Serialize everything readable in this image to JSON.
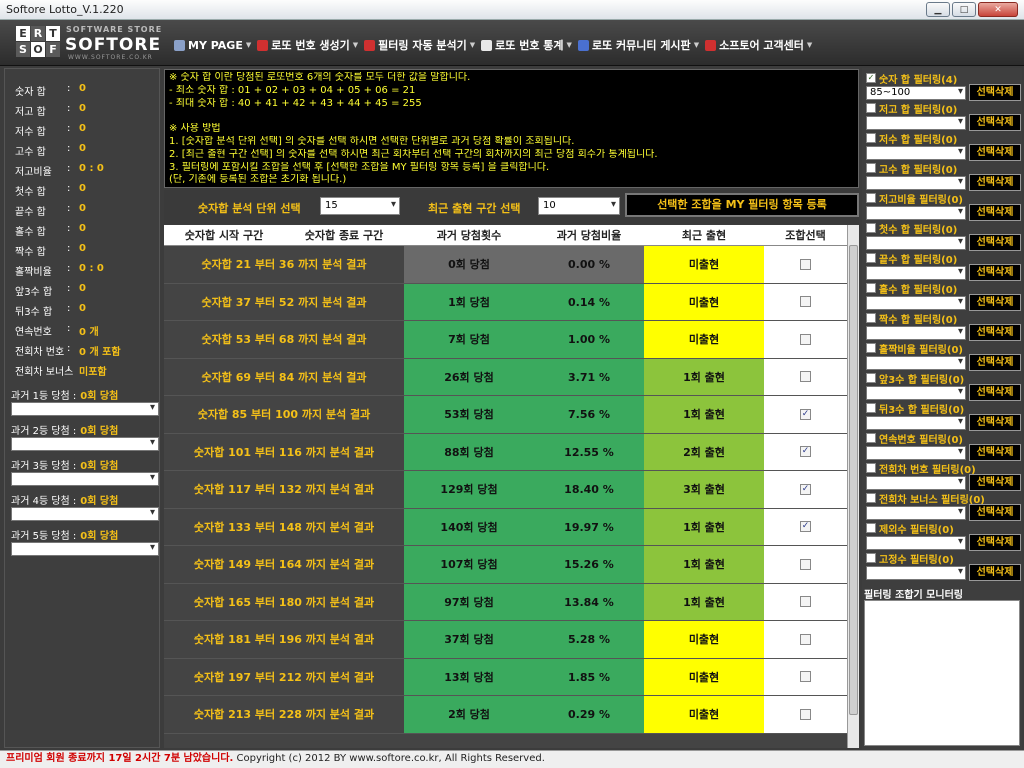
{
  "window": {
    "title": "Softore Lotto_V.1.220"
  },
  "logo": {
    "letters": [
      "E",
      "R",
      "T",
      "S",
      "O",
      "F"
    ],
    "sub1": "SOFTWARE STORE",
    "main": "SOFTORE",
    "sub2": "WWW.SOFTORE.CO.KR"
  },
  "menu": [
    {
      "label": "MY PAGE",
      "icon": "grid-icon",
      "color": "#8aa0c8"
    },
    {
      "label": "로또 번호 생성기",
      "icon": "dice-icon",
      "color": "#d03030"
    },
    {
      "label": "필터링 자동 분석기",
      "icon": "dice-icon",
      "color": "#d03030"
    },
    {
      "label": "로또 번호 통계",
      "icon": "document-icon",
      "color": "#e8e8e8"
    },
    {
      "label": "로또 커뮤니티 게시판",
      "icon": "board-icon",
      "color": "#4a70d0"
    },
    {
      "label": "소프토어 고객센터",
      "icon": "help-icon",
      "color": "#d03030"
    }
  ],
  "left_stats": [
    {
      "label": "숫자 합",
      "value": "0"
    },
    {
      "label": "저고 합",
      "value": "0"
    },
    {
      "label": "저수 합",
      "value": "0"
    },
    {
      "label": "고수 합",
      "value": "0"
    },
    {
      "label": "저고비율",
      "value": "0 : 0"
    },
    {
      "label": "첫수 합",
      "value": "0"
    },
    {
      "label": "끝수 합",
      "value": "0"
    },
    {
      "label": "홀수 합",
      "value": "0"
    },
    {
      "label": "짝수 합",
      "value": "0"
    },
    {
      "label": "홀짝비율",
      "value": "0 : 0"
    },
    {
      "label": "앞3수 합",
      "value": "0"
    },
    {
      "label": "뒤3수 합",
      "value": "0"
    },
    {
      "label": "연속번호",
      "value": "0 개"
    },
    {
      "label": "전회차 번호",
      "value": "0 개 포함"
    },
    {
      "label": "전회차 보너스",
      "value": "미포함"
    }
  ],
  "past_wins": [
    {
      "label": "과거 1등 당첨 :",
      "value": "0회 당첨"
    },
    {
      "label": "과거 2등 당첨 :",
      "value": "0회 당첨"
    },
    {
      "label": "과거 3등 당첨 :",
      "value": "0회 당첨"
    },
    {
      "label": "과거 4등 당첨 :",
      "value": "0회 당첨"
    },
    {
      "label": "과거 5등 당첨 :",
      "value": "0회 당첨"
    }
  ],
  "info_lines": [
    "※ 숫자 합 이란 당첨된 로또번호 6개의 숫자를 모두 더한 값을 말합니다.",
    " - 최소 숫자 합 : 01 + 02 + 03 + 04 + 05 + 06 = 21",
    " - 최대 숫자 합 : 40 + 41 + 42 + 43 + 44 + 45 = 255",
    "",
    "※ 사용 방법",
    "1. [숫자합 분석 단위 선택] 의 숫자를 선택 하시면 선택한 단위별로 과거 당첨 확률이 조회됩니다.",
    "2. [최근 출현 구간 선택] 의 숫자를 선택 하시면 최근 회차부터 선택 구간의 회차까지의 최근 당첨 회수가 통계됩니다.",
    "3. 필터링에 포함시킬 조합을 선택 후 [선택한 조합을 MY 필터링 항목 등록] 을 클릭합니다.",
    "(단, 기존에 등록된 조합은 초기화 됩니다.)"
  ],
  "options": {
    "unit_label": "숫자합 분석 단위 선택",
    "unit_value": "15",
    "range_label": "최근 출현 구간 선택",
    "range_value": "10",
    "register_button": "선택한 조합을 MY 필터링 항목 등록"
  },
  "table": {
    "headers": [
      "숫자합 시작 구간",
      "숫자합 종료 구간",
      "과거 당첨횟수",
      "과거 당첨비율",
      "최근 출현",
      "조합선택"
    ],
    "rows": [
      {
        "range": "숫자합 21 부터  36 까지 분석 결과",
        "count": "0회 당첨",
        "ratio": "0.00 %",
        "recent": "미출현",
        "checked": false
      },
      {
        "range": "숫자합 37 부터  52 까지 분석 결과",
        "count": "1회 당첨",
        "ratio": "0.14 %",
        "recent": "미출현",
        "checked": false
      },
      {
        "range": "숫자합 53 부터  68 까지 분석 결과",
        "count": "7회 당첨",
        "ratio": "1.00 %",
        "recent": "미출현",
        "checked": false
      },
      {
        "range": "숫자합 69 부터  84 까지 분석 결과",
        "count": "26회 당첨",
        "ratio": "3.71 %",
        "recent": "1회 출현",
        "checked": false
      },
      {
        "range": "숫자합 85 부터  100 까지 분석 결과",
        "count": "53회 당첨",
        "ratio": "7.56 %",
        "recent": "1회 출현",
        "checked": true
      },
      {
        "range": "숫자합 101 부터  116 까지 분석 결과",
        "count": "88회 당첨",
        "ratio": "12.55 %",
        "recent": "2회 출현",
        "checked": true
      },
      {
        "range": "숫자합 117 부터  132 까지 분석 결과",
        "count": "129회 당첨",
        "ratio": "18.40 %",
        "recent": "3회 출현",
        "checked": true
      },
      {
        "range": "숫자합 133 부터  148 까지 분석 결과",
        "count": "140회 당첨",
        "ratio": "19.97 %",
        "recent": "1회 출현",
        "checked": true
      },
      {
        "range": "숫자합 149 부터  164 까지 분석 결과",
        "count": "107회 당첨",
        "ratio": "15.26 %",
        "recent": "1회 출현",
        "checked": false
      },
      {
        "range": "숫자합 165 부터  180 까지 분석 결과",
        "count": "97회 당첨",
        "ratio": "13.84 %",
        "recent": "1회 출현",
        "checked": false
      },
      {
        "range": "숫자합 181 부터  196 까지 분석 결과",
        "count": "37회 당첨",
        "ratio": "5.28 %",
        "recent": "미출현",
        "checked": false
      },
      {
        "range": "숫자합 197 부터  212 까지 분석 결과",
        "count": "13회 당첨",
        "ratio": "1.85 %",
        "recent": "미출현",
        "checked": false
      },
      {
        "range": "숫자합 213 부터  228 까지 분석 결과",
        "count": "2회 당첨",
        "ratio": "0.29 %",
        "recent": "미출현",
        "checked": false
      }
    ]
  },
  "colors": {
    "green": "#3aaa5e",
    "grey": "#6a6a6a",
    "yellow": "#ffff00",
    "lime": "#8cc43c",
    "gold": "#f4c018"
  },
  "filters": [
    {
      "label": "숫자 합 필터링(4)",
      "checked": true,
      "value": "85~100"
    },
    {
      "label": "저고 합 필터링(0)",
      "checked": false,
      "value": ""
    },
    {
      "label": "저수 합 필터링(0)",
      "checked": false,
      "value": ""
    },
    {
      "label": "고수 합 필터링(0)",
      "checked": false,
      "value": ""
    },
    {
      "label": "저고비율 필터링(0)",
      "checked": false,
      "value": ""
    },
    {
      "label": "첫수 합 필터링(0)",
      "checked": false,
      "value": ""
    },
    {
      "label": "끝수 합 필터링(0)",
      "checked": false,
      "value": ""
    },
    {
      "label": "홀수 합 필터링(0)",
      "checked": false,
      "value": ""
    },
    {
      "label": "짝수 합 필터링(0)",
      "checked": false,
      "value": ""
    },
    {
      "label": "홀짝비율 필터링(0)",
      "checked": false,
      "value": ""
    },
    {
      "label": "앞3수 합 필터링(0)",
      "checked": false,
      "value": ""
    },
    {
      "label": "뒤3수 합 필터링(0)",
      "checked": false,
      "value": ""
    },
    {
      "label": "연속번호 필터링(0)",
      "checked": false,
      "value": ""
    },
    {
      "label": "전회차 번호 필터링(0)",
      "checked": false,
      "value": ""
    },
    {
      "label": "전회차 보너스 필터링(0)",
      "checked": false,
      "value": ""
    },
    {
      "label": "제외수 필터링(0)",
      "checked": false,
      "value": ""
    },
    {
      "label": "고정수 필터링(0)",
      "checked": false,
      "value": ""
    }
  ],
  "filter_button": "선택삭제",
  "monitor_label": "필터링 조합기 모니터링",
  "status": {
    "premium": "프리미엄 회원 종료까지 17일 2시간 7분 남았습니다.",
    "copyright": "Copyright (c) 2012 BY www.softore.co.kr, All Rights Reserved."
  }
}
